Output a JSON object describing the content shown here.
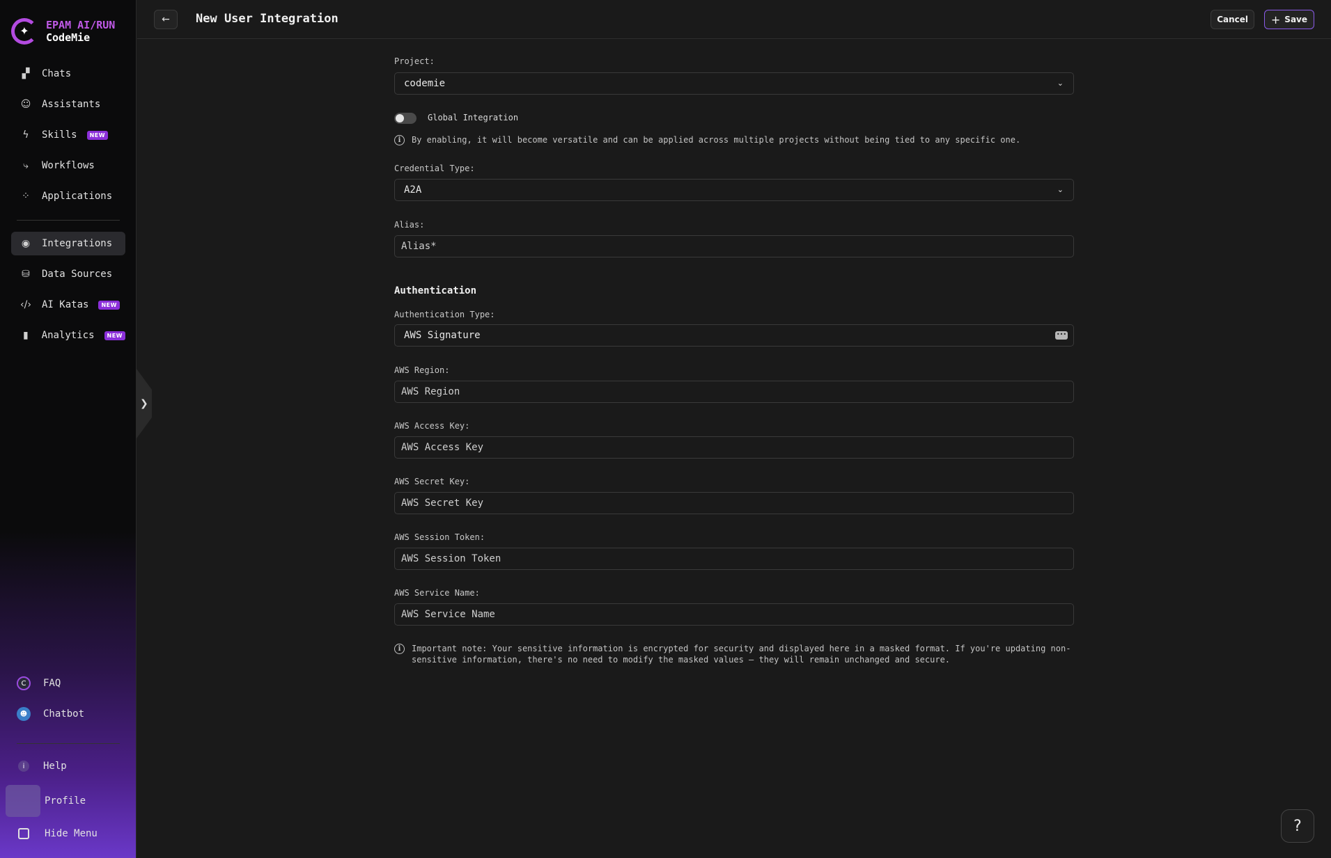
{
  "brand": {
    "line1": "EPAM AI/RUN",
    "line2": "CodeMie"
  },
  "sidebar": {
    "items": [
      {
        "label": "Chats",
        "icon": "chats-icon",
        "badge": ""
      },
      {
        "label": "Assistants",
        "icon": "assistants-icon",
        "badge": ""
      },
      {
        "label": "Skills",
        "icon": "skills-icon",
        "badge": "NEW"
      },
      {
        "label": "Workflows",
        "icon": "workflows-icon",
        "badge": ""
      },
      {
        "label": "Applications",
        "icon": "applications-icon",
        "badge": ""
      }
    ],
    "items2": [
      {
        "label": "Integrations",
        "icon": "integrations-icon",
        "badge": "",
        "active": true
      },
      {
        "label": "Data Sources",
        "icon": "data-sources-icon",
        "badge": ""
      },
      {
        "label": "AI Katas",
        "icon": "ai-katas-icon",
        "badge": "NEW"
      },
      {
        "label": "Analytics",
        "icon": "analytics-icon",
        "badge": "NEW"
      }
    ],
    "faq": "FAQ",
    "chatbot": "Chatbot",
    "help": "Help",
    "profile": "Profile",
    "hide_menu": "Hide Menu"
  },
  "header": {
    "title": "New User Integration",
    "cancel": "Cancel",
    "save": "Save"
  },
  "form": {
    "project_label": "Project:",
    "project_value": "codemie",
    "global_label": "Global Integration",
    "global_enabled": false,
    "global_info": "By enabling, it will become versatile and can be applied across multiple projects without being tied to any specific one.",
    "credential_label": "Credential Type:",
    "credential_value": "A2A",
    "alias_label": "Alias:",
    "alias_placeholder": "Alias*",
    "auth_section": "Authentication",
    "auth_type_label": "Authentication Type:",
    "auth_type_value": "AWS Signature",
    "region_label": "AWS Region:",
    "region_placeholder": "AWS Region",
    "access_label": "AWS Access Key:",
    "access_placeholder": "AWS Access Key",
    "secret_label": "AWS Secret Key:",
    "secret_placeholder": "AWS Secret Key",
    "session_label": "AWS Session Token:",
    "session_placeholder": "AWS Session Token",
    "service_label": "AWS Service Name:",
    "service_placeholder": "AWS Service Name",
    "note_line1": "Important note: Your sensitive information is encrypted for security and displayed here in a masked format. If you're updating non-",
    "note_line2": "sensitive information, there's no need to modify the masked values – they will remain unchanged and secure."
  },
  "help_fab": "?",
  "colors": {
    "accent": "#8a5be8",
    "badge": "#8b2fd9",
    "brand": "#c05ae8"
  }
}
